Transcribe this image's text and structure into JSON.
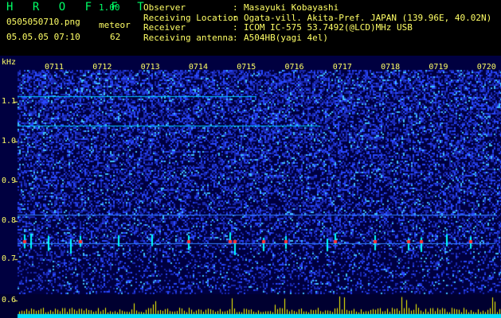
{
  "header": {
    "logo": "H R O F F T",
    "version": "1.00",
    "filename": "0505050710.png",
    "meteor_label": "meteor",
    "datetime": "05.05.05 07:10",
    "meteor_count": "62"
  },
  "info": [
    {
      "key": "Observer",
      "value": "Masayuki Kobayashi"
    },
    {
      "key": "Receiving Location",
      "value": "Ogata-vill. Akita-Pref. JAPAN (139.96E, 40.02N)"
    },
    {
      "key": "Receiver",
      "value": "ICOM IC-575 53.7492(@LCD)MHz USB"
    },
    {
      "key": "Receiving antenna",
      "value": "A504HB(yagi 4el)"
    }
  ],
  "chart_data": {
    "type": "heatmap",
    "ylabel": "kHz",
    "y_ticks": [
      "1.1",
      "1.0",
      "0.9",
      "0.8",
      "0.7",
      "0.6"
    ],
    "x_ticks": [
      "0711",
      "0712",
      "0713",
      "0714",
      "0715",
      "0716",
      "0717",
      "0718",
      "0719",
      "0720"
    ],
    "colors": {
      "background": "#000040",
      "noise": "#2040ff",
      "signal": "#00ffff",
      "echo": "#ff3030",
      "label": "#ffff66",
      "bars": "#ffff00",
      "baseline": "#00e0ff"
    }
  }
}
